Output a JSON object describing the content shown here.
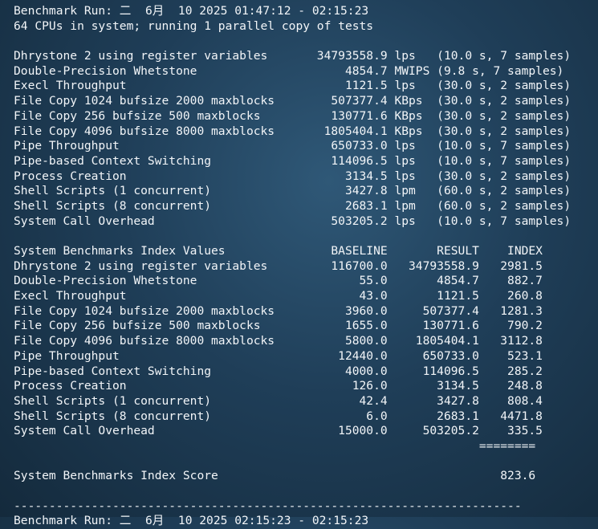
{
  "header": {
    "run_line": "Benchmark Run: 二  6月  10 2025 01:47:12 - 02:15:23",
    "cpu_line": "64 CPUs in system; running 1 parallel copy of tests"
  },
  "results": [
    "Dhrystone 2 using register variables       34793558.9 lps   (10.0 s, 7 samples)",
    "Double-Precision Whetstone                     4854.7 MWIPS (9.8 s, 7 samples)",
    "Execl Throughput                               1121.5 lps   (30.0 s, 2 samples)",
    "File Copy 1024 bufsize 2000 maxblocks        507377.4 KBps  (30.0 s, 2 samples)",
    "File Copy 256 bufsize 500 maxblocks          130771.6 KBps  (30.0 s, 2 samples)",
    "File Copy 4096 bufsize 8000 maxblocks       1805404.1 KBps  (30.0 s, 2 samples)",
    "Pipe Throughput                              650733.0 lps   (10.0 s, 7 samples)",
    "Pipe-based Context Switching                 114096.5 lps   (10.0 s, 7 samples)",
    "Process Creation                               3134.5 lps   (30.0 s, 2 samples)",
    "Shell Scripts (1 concurrent)                   3427.8 lpm   (60.0 s, 2 samples)",
    "Shell Scripts (8 concurrent)                   2683.1 lpm   (60.0 s, 2 samples)",
    "System Call Overhead                         503205.2 lps   (10.0 s, 7 samples)"
  ],
  "index": {
    "header": "System Benchmarks Index Values               BASELINE       RESULT    INDEX",
    "rows": [
      "Dhrystone 2 using register variables         116700.0   34793558.9   2981.5",
      "Double-Precision Whetstone                       55.0       4854.7    882.7",
      "Execl Throughput                                 43.0       1121.5    260.8",
      "File Copy 1024 bufsize 2000 maxblocks          3960.0     507377.4   1281.3",
      "File Copy 256 bufsize 500 maxblocks            1655.0     130771.6    790.2",
      "File Copy 4096 bufsize 8000 maxblocks          5800.0    1805404.1   3112.8",
      "Pipe Throughput                               12440.0     650733.0    523.1",
      "Pipe-based Context Switching                   4000.0     114096.5    285.2",
      "Process Creation                                126.0       3134.5    248.8",
      "Shell Scripts (1 concurrent)                     42.4       3427.8    808.4",
      "Shell Scripts (8 concurrent)                      6.0       2683.1   4471.8",
      "System Call Overhead                          15000.0     503205.2    335.5"
    ],
    "separator": "                                                                  ========",
    "score_line": "System Benchmarks Index Score                                        823.6"
  },
  "divider": "------------------------------------------------------------------------",
  "footer": {
    "run_line": "Benchmark Run: 二  6月  10 2025 02:15:23 - 02:15:23"
  }
}
